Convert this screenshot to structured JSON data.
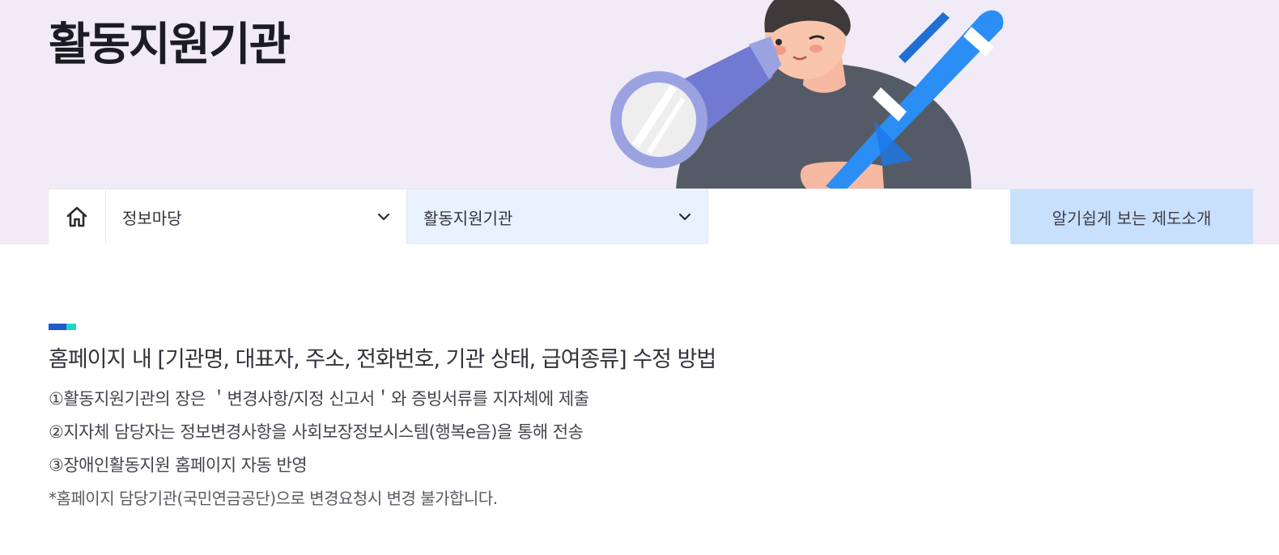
{
  "hero": {
    "title": "활동지원기관",
    "bg_color": "#f1ebf8"
  },
  "nav": {
    "home_icon": "home-icon",
    "depth1_label": "정보마당",
    "depth2_label": "활동지원기관",
    "dropdown_icon": "chevron-down-icon",
    "intro_button_label": "알기쉽게 보는 제도소개",
    "intro_button_color": "#c9e0fc",
    "active_select_color": "#e8f2fe"
  },
  "content": {
    "section_title": "홈페이지 내 [기관명, 대표자, 주소, 전화번호, 기관 상태, 급여종류] 수정 방법",
    "steps": [
      "①활동지원기관의 장은 ＇변경사항/지정 신고서＇와 증빙서류를 지자체에 제출",
      "②지자체 담당자는 정보변경사항을 사회보장정보시스템(행복e음)을 통해 전송",
      "③장애인활동지원 홈페이지 자동 반영"
    ],
    "note": "*홈페이지 담당기관(국민연금공단)으로 변경요청시 변경 불가합니다."
  },
  "colors": {
    "accent_blue": "#1f5cc9",
    "accent_teal": "#20d6c6"
  }
}
